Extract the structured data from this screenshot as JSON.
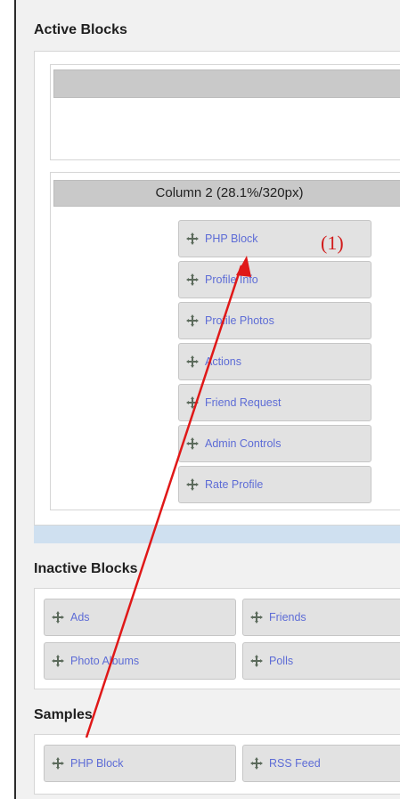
{
  "sections": {
    "active_title": "Active Blocks",
    "inactive_title": "Inactive Blocks",
    "samples_title": "Samples"
  },
  "column2": {
    "header": "Column 2 (28.1%/320px)",
    "blocks": [
      "PHP Block",
      "Profile Info",
      "Profile Photos",
      "Actions",
      "Friend Request",
      "Admin Controls",
      "Rate Profile"
    ]
  },
  "inactive_blocks": [
    "Ads",
    "Friends",
    "Photo Albums",
    "Polls"
  ],
  "sample_blocks": [
    "PHP Block",
    "RSS Feed"
  ],
  "annotation": {
    "label": "(1)",
    "color": "#d11b1b"
  },
  "colors": {
    "link": "#5d6cd6",
    "column_bar": "#c9c9c9",
    "block_bg": "#e2e2e2",
    "highlight_band": "#cfe0f0"
  },
  "icons": {
    "block_handle": "move-arrows-icon"
  }
}
